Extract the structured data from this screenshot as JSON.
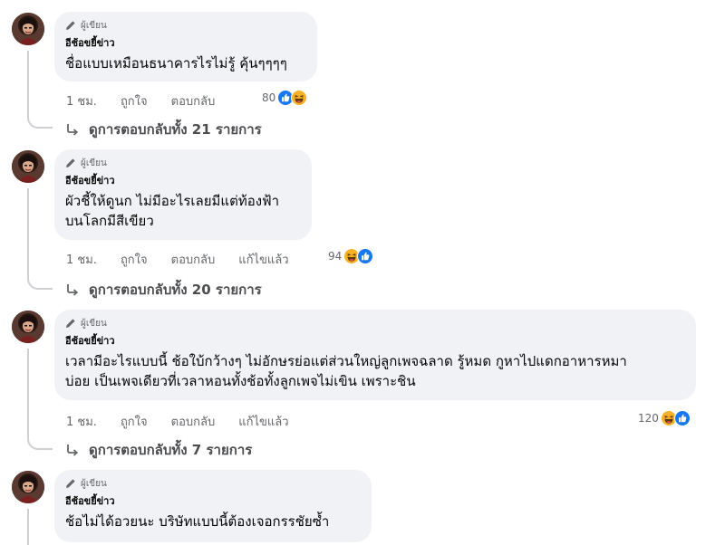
{
  "comments": [
    {
      "badge": "ผู้เขียน",
      "author": "อีช้อขยี้ข่าว",
      "lines": [
        "ชื่อแบบเหมือนธนาคารไรไม่รู้ คุ้นๆๆๆๆ"
      ],
      "time": "1 ชม.",
      "like": "ถูกใจ",
      "reply": "ตอบกลับ",
      "edited": "",
      "reaction_count": "80",
      "reaction_icons": [
        "like-icon",
        "haha-icon"
      ],
      "view_replies": "ดูการตอบกลับทั้ง 21 รายการ"
    },
    {
      "badge": "ผู้เขียน",
      "author": "อีช้อขยี้ข่าว",
      "lines": [
        "ผัวชี้ให้ดูนก ไม่มีอะไรเลยมีแต่ท้องฟ้า",
        "บนโลกมีสีเขียว"
      ],
      "time": "1 ชม.",
      "like": "ถูกใจ",
      "reply": "ตอบกลับ",
      "edited": "แก้ไขแล้ว",
      "reaction_count": "94",
      "reaction_icons": [
        "haha-icon",
        "like-icon"
      ],
      "view_replies": "ดูการตอบกลับทั้ง 20 รายการ"
    },
    {
      "badge": "ผู้เขียน",
      "author": "อีช้อขยี้ข่าว",
      "lines": [
        "เวลามีอะไรแบบนี้ ช้อใบ้กว้างๆ ไม่อักษรย่อแต่ส่วนใหญ่ลูกเพจฉลาด รู้หมด กูหาไปแดกอาหารหมา",
        "บ่อย เป็นเพจเดียวที่เวลาหอนทั้งช้อทั้งลูกเพจไม่เขิน เพราะชิน"
      ],
      "time": "1 ชม.",
      "like": "ถูกใจ",
      "reply": "ตอบกลับ",
      "edited": "แก้ไขแล้ว",
      "reaction_count": "120",
      "reaction_icons": [
        "haha-icon",
        "like-icon"
      ],
      "view_replies": "ดูการตอบกลับทั้ง 7 รายการ"
    },
    {
      "badge": "ผู้เขียน",
      "author": "อีช้อขยี้ข่าว",
      "lines": [
        "ช้อไม่ได้อวยนะ บริษัทแบบนี้ต้องเจอกรรชัยซ้ำ"
      ]
    }
  ],
  "colors": {
    "like_blue": "#1877f2",
    "haha_yellow": "#f7b125",
    "bubble_bg": "#f0f2f5",
    "thread_line": "#ced0d4"
  }
}
